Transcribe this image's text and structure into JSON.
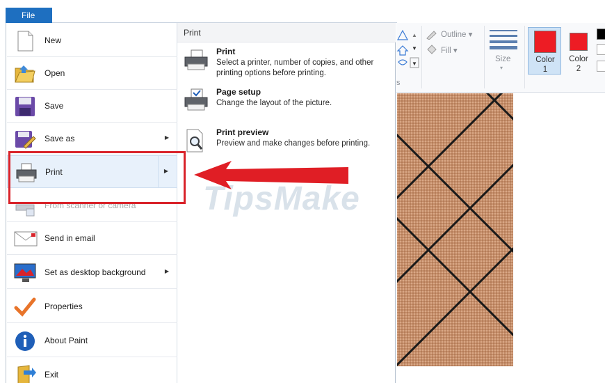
{
  "file_tab": {
    "label": "File"
  },
  "menu": {
    "items": [
      {
        "id": "new",
        "label": "New",
        "arrow": false
      },
      {
        "id": "open",
        "label": "Open",
        "arrow": false
      },
      {
        "id": "save",
        "label": "Save",
        "arrow": false
      },
      {
        "id": "save-as",
        "label": "Save as",
        "arrow": true
      },
      {
        "id": "print",
        "label": "Print",
        "arrow": true,
        "active": true
      },
      {
        "id": "from-scanner",
        "label": "From scanner or camera",
        "arrow": false,
        "disabled": true
      },
      {
        "id": "send-email",
        "label": "Send in email",
        "arrow": false
      },
      {
        "id": "desktop-bg",
        "label": "Set as desktop background",
        "arrow": true
      },
      {
        "id": "properties",
        "label": "Properties",
        "arrow": false
      },
      {
        "id": "about",
        "label": "About Paint",
        "arrow": false
      },
      {
        "id": "exit",
        "label": "Exit",
        "arrow": false
      }
    ]
  },
  "submenu": {
    "title": "Print",
    "items": [
      {
        "title": "Print",
        "desc": "Select a printer, number of copies, and other printing options before printing."
      },
      {
        "title": "Page setup",
        "desc": "Change the layout of the picture."
      },
      {
        "title": "Print preview",
        "desc": "Preview and make changes before printing."
      }
    ]
  },
  "ribbon": {
    "outline_label": "Outline",
    "fill_label": "Fill",
    "size_label": "Size",
    "color1_label": [
      "Color",
      "1"
    ],
    "color2_label": [
      "Color",
      "2"
    ],
    "color1_value": "#ed1c24",
    "color2_value": "#ed1c24",
    "group_fragment": "s"
  },
  "watermark": "TipsMake",
  "colors": {
    "accent": "#1e6fc0",
    "highlight": "#d9232a",
    "arrow": "#e01e25"
  }
}
